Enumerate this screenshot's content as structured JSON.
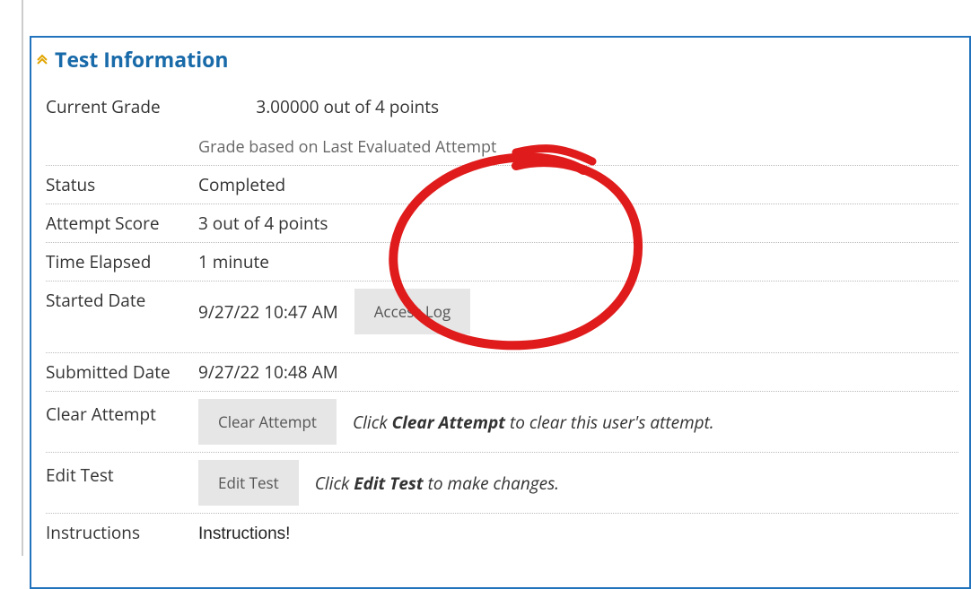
{
  "section_title": "Test Information",
  "rows": {
    "current_grade": {
      "label": "Current Grade",
      "value": "3.00000 out of 4 points",
      "subtext": "Grade based on Last Evaluated Attempt"
    },
    "status": {
      "label": "Status",
      "value": "Completed"
    },
    "attempt_score": {
      "label": "Attempt Score",
      "value": "3 out of 4 points"
    },
    "time_elapsed": {
      "label": "Time Elapsed",
      "value": "1 minute"
    },
    "started": {
      "label": "Started Date",
      "value": "9/27/22 10:47 AM",
      "button": "Access Log"
    },
    "submitted": {
      "label": "Submitted Date",
      "value": "9/27/22 10:48 AM"
    },
    "clear_attempt": {
      "label": "Clear Attempt",
      "button": "Clear Attempt",
      "hint_prefix": "Click ",
      "hint_bold": "Clear Attempt",
      "hint_suffix": " to clear this user's attempt."
    },
    "edit_test": {
      "label": "Edit Test",
      "button": "Edit Test",
      "hint_prefix": "Click ",
      "hint_bold": "Edit Test",
      "hint_suffix": " to make changes."
    },
    "instructions": {
      "label": "Instructions",
      "value": "Instructions!"
    }
  }
}
